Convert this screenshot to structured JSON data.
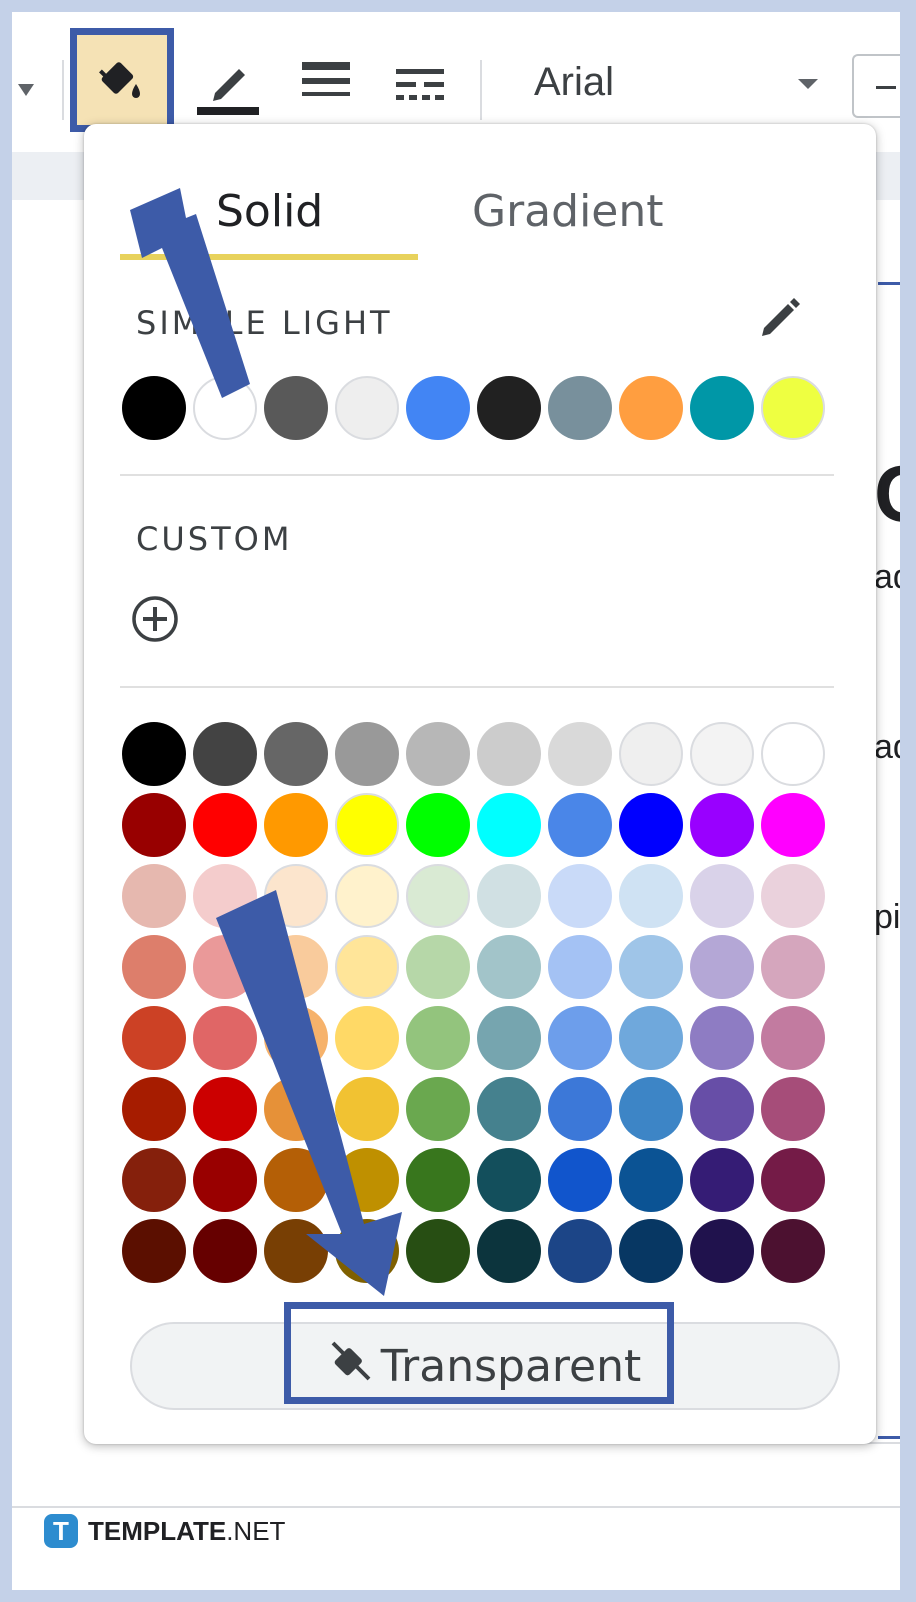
{
  "toolbar": {
    "fill_icon": "paint-bucket-icon",
    "border_color_icon": "pencil-icon",
    "border_weight_icon": "line-weight-icon",
    "border_dash_icon": "line-dash-icon",
    "font_name": "Arial",
    "dropdown_icon": "chevron-down-icon"
  },
  "tabs": [
    {
      "label": "Solid",
      "active": true
    },
    {
      "label": "Gradient",
      "active": false
    }
  ],
  "theme_section": {
    "label": "SIMPLE LIGHT",
    "edit_icon": "pencil-icon",
    "colors": [
      "#000000",
      "#ffffff",
      "#595959",
      "#eeeeee",
      "#4285f4",
      "#212121",
      "#78909c",
      "#ff9e40",
      "#0097a7",
      "#eeff41"
    ]
  },
  "custom_section": {
    "label": "CUSTOM",
    "add_icon": "add-circle-icon"
  },
  "palette": [
    [
      "#000000",
      "#434343",
      "#666666",
      "#999999",
      "#b7b7b7",
      "#cccccc",
      "#d9d9d9",
      "#efefef",
      "#f3f3f3",
      "#ffffff"
    ],
    [
      "#980000",
      "#ff0000",
      "#ff9900",
      "#ffff00",
      "#00ff00",
      "#00ffff",
      "#4a86e8",
      "#0000ff",
      "#9900ff",
      "#ff00ff"
    ],
    [
      "#e6b8af",
      "#f4cccc",
      "#fce5cd",
      "#fff2cc",
      "#d9ead3",
      "#d0e0e3",
      "#c9daf8",
      "#cfe2f3",
      "#d9d2e9",
      "#ead1dc"
    ],
    [
      "#dd7e6b",
      "#ea9999",
      "#f9cb9c",
      "#ffe599",
      "#b6d7a8",
      "#a2c4c9",
      "#a4c2f4",
      "#9fc5e8",
      "#b4a7d6",
      "#d5a6bd"
    ],
    [
      "#cc4125",
      "#e06666",
      "#f6b26b",
      "#ffd966",
      "#93c47d",
      "#76a5af",
      "#6d9eeb",
      "#6fa8dc",
      "#8e7cc3",
      "#c27ba0"
    ],
    [
      "#a61c00",
      "#cc0000",
      "#e69138",
      "#f1c232",
      "#6aa84f",
      "#45818e",
      "#3c78d8",
      "#3d85c6",
      "#674ea7",
      "#a64d79"
    ],
    [
      "#85200c",
      "#990000",
      "#b45f06",
      "#bf9000",
      "#38761d",
      "#134f5c",
      "#1155cc",
      "#0b5394",
      "#351c75",
      "#741b47"
    ],
    [
      "#5b0f00",
      "#660000",
      "#783f04",
      "#7f6000",
      "#274e13",
      "#0c343d",
      "#1c4587",
      "#073763",
      "#20124d",
      "#4c1130"
    ]
  ],
  "transparent_button": {
    "label": "Transparent",
    "icon": "paint-bucket-off-icon"
  },
  "side_text": [
    "C",
    "ad",
    "ad",
    "pi"
  ],
  "footer": {
    "logo_letter": "T",
    "brand_bold": "TEMPLATE",
    "brand_light": ".NET"
  },
  "colors": {
    "highlight": "#3d5ba8",
    "active_tab_underline": "#e8d25c",
    "fill_button_bg": "#f5e2b5"
  }
}
